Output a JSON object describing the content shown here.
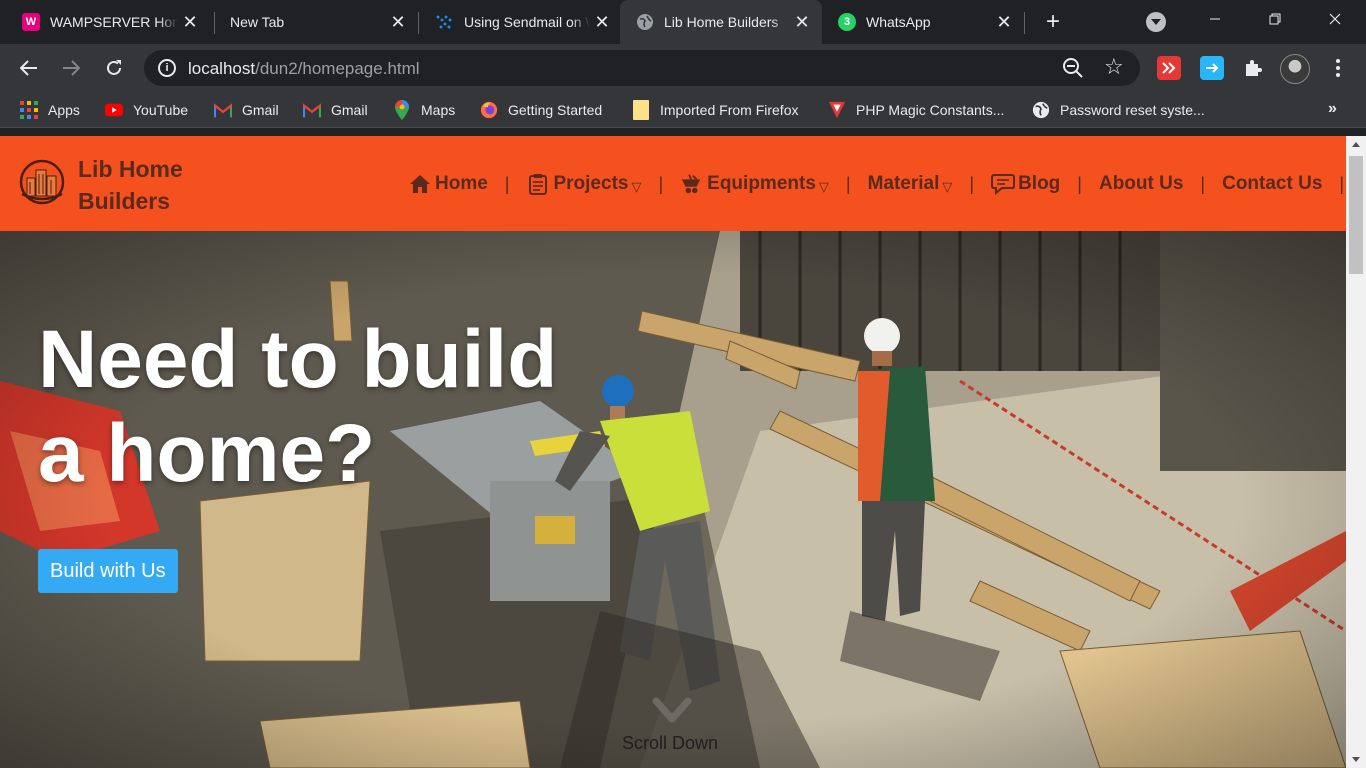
{
  "browser": {
    "tabs": [
      {
        "title": "WAMPSERVER Homepage",
        "icon": "wampserver-icon",
        "active": false
      },
      {
        "title": "New Tab",
        "icon": "",
        "active": false
      },
      {
        "title": "Using Sendmail on Windows",
        "icon": "sendmail-icon",
        "active": false
      },
      {
        "title": "Lib Home Builders",
        "icon": "globe-icon",
        "active": true
      },
      {
        "title": "WhatsApp",
        "icon": "whatsapp-icon",
        "active": false,
        "badge": "3"
      }
    ],
    "url_host": "localhost",
    "url_path": "/dun2/homepage.html",
    "bookmarks": [
      {
        "label": "Apps",
        "icon": "apps-grid-icon"
      },
      {
        "label": "YouTube",
        "icon": "youtube-icon"
      },
      {
        "label": "Gmail",
        "icon": "gmail-icon"
      },
      {
        "label": "Gmail",
        "icon": "gmail-icon"
      },
      {
        "label": "Maps",
        "icon": "maps-pin-icon"
      },
      {
        "label": "Getting Started",
        "icon": "firefox-icon"
      },
      {
        "label": "Imported From Firefox",
        "icon": "folder-icon"
      },
      {
        "label": "PHP Magic Constants...",
        "icon": "php-icon"
      },
      {
        "label": "Password reset syste...",
        "icon": "globe-icon"
      }
    ],
    "bookmarks_overflow": "»"
  },
  "site": {
    "brand": "Lib Home Builders",
    "brand_color": "#f5511e",
    "nav": [
      {
        "label": "Home",
        "icon": "house-icon",
        "dropdown": false
      },
      {
        "label": "Projects",
        "icon": "clipboard-icon",
        "dropdown": true
      },
      {
        "label": "Equipments",
        "icon": "wheelbarrow-icon",
        "dropdown": true
      },
      {
        "label": "Material",
        "icon": "",
        "dropdown": true
      },
      {
        "label": "Blog",
        "icon": "chat-bubble-icon",
        "dropdown": false
      },
      {
        "label": "About Us",
        "icon": "",
        "dropdown": false
      },
      {
        "label": "Contact Us",
        "icon": "",
        "dropdown": false
      }
    ],
    "nav_separator": "|",
    "dropdown_caret": "▽",
    "hero": {
      "headline_line1": "Need to build",
      "headline_line2": "a home?",
      "cta_label": "Build with Us",
      "cta_color": "#33aaf3",
      "scroll_label": "Scroll Down"
    }
  }
}
